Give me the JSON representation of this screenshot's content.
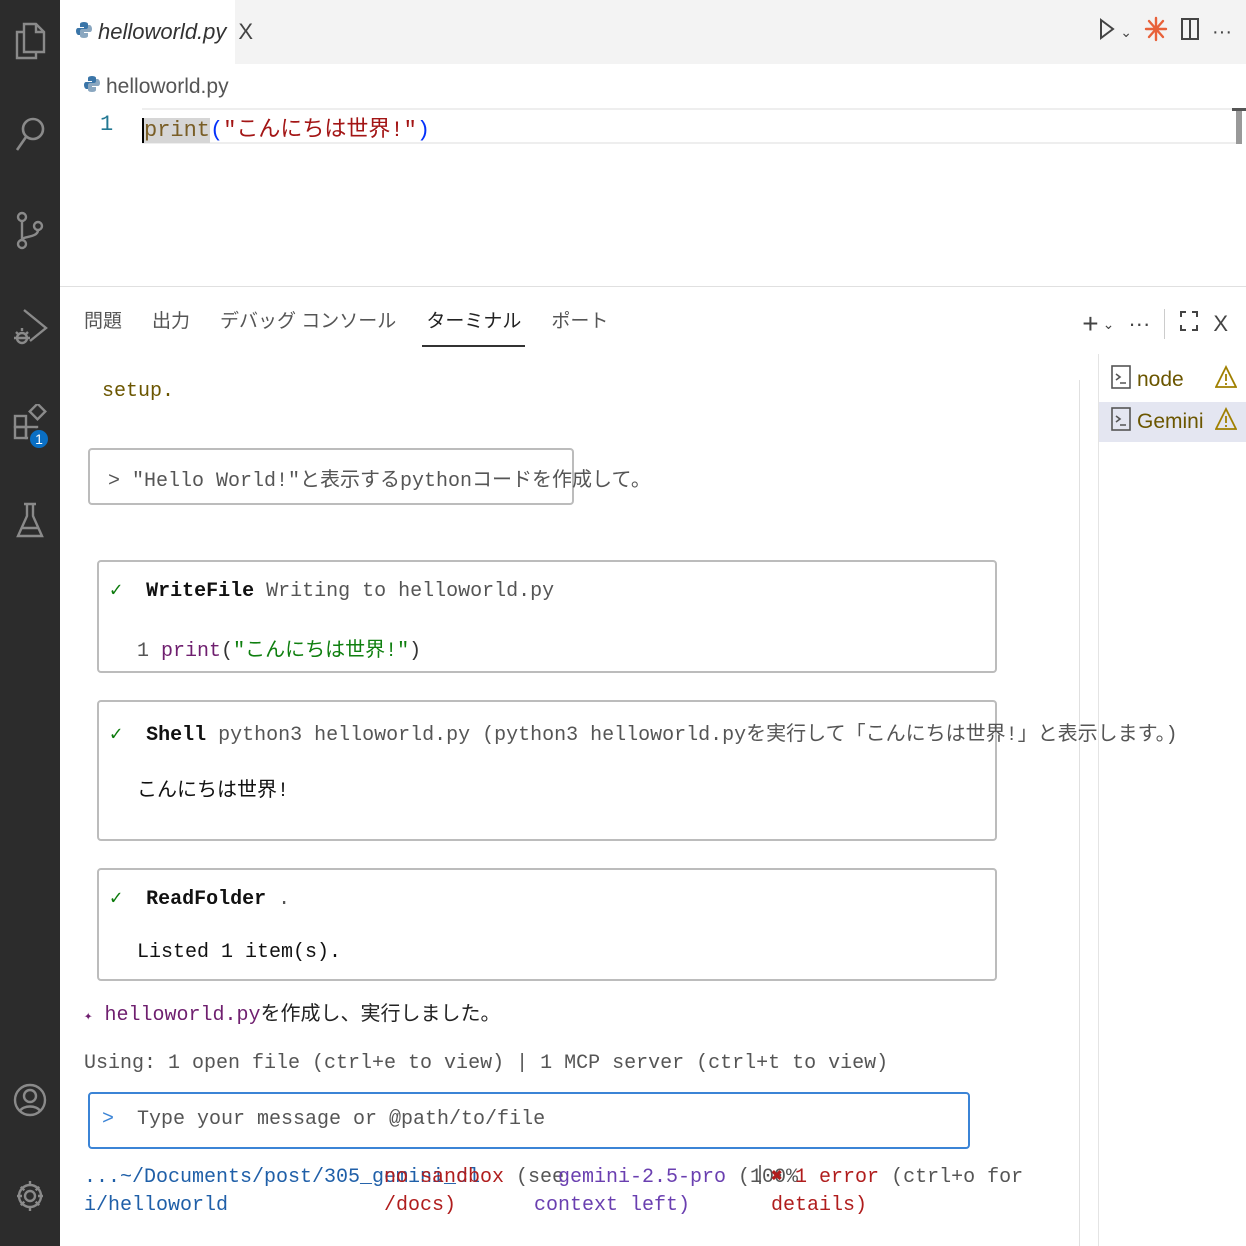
{
  "editor": {
    "tab_label": "helloworld.py",
    "tab_close": "X",
    "breadcrumb": "helloworld.py",
    "line_number": "1",
    "code": {
      "fn": "print",
      "open": "(",
      "string": "\"こんにちは世界!\"",
      "close": ")"
    }
  },
  "activity_bar": {
    "extensions_badge": "1"
  },
  "panel": {
    "tabs": [
      "問題",
      "出力",
      "デバッグ コンソール",
      "ターミナル",
      "ポート"
    ],
    "active_tab": "ターミナル"
  },
  "terminals": [
    {
      "name": "node",
      "selected": false
    },
    {
      "name": "Gemini ...",
      "selected": true
    }
  ],
  "terminal": {
    "setup_line": "setup.",
    "prompt_echo": "> \"Hello World!\"と表示するpythonコードを作成して。",
    "tool_calls": [
      {
        "status": "✓",
        "tool": "WriteFile",
        "desc": "Writing to helloworld.py",
        "output_linenum": "1",
        "output_fn": "print",
        "output_open": "(",
        "output_str": "\"こんにちは世界!\"",
        "output_close": ")"
      },
      {
        "status": "✓",
        "tool": "Shell",
        "desc": "python3 helloworld.py (python3 helloworld.pyを実行して「こんにちは世界!」と表示します。)",
        "output": "こんにちは世界!"
      },
      {
        "status": "✓",
        "tool": "ReadFolder",
        "desc": ".",
        "output": "Listed 1 item(s)."
      }
    ],
    "response_marker": "✦",
    "response_file": "helloworld.py",
    "response_text": "を作成し、実行しました。",
    "context_line": "Using: 1 open file (ctrl+e to view) | 1 MCP server (ctrl+t to view)",
    "input_prompt": ">",
    "input_placeholder": "Type your message or @path/to/file",
    "footer": {
      "path_line1": "...~/Documents/post/305_gemini_cl",
      "path_line2": "i/helloworld",
      "sandbox_a": "no sandbox",
      "sandbox_b": " (see",
      "sandbox_c": "/docs)",
      "model_a": "gemini-2.5-pro",
      "model_b": " (100%",
      "model_c": "context left)",
      "sep": "|",
      "error_mark": "✖",
      "error_a": " 1 error",
      "error_b": " (ctrl+o for",
      "error_c": "details)"
    }
  },
  "colors": {
    "accent": "#0a6fc4",
    "activity_bg": "#2c2c2c",
    "gemini_icon": "#e8613a"
  }
}
